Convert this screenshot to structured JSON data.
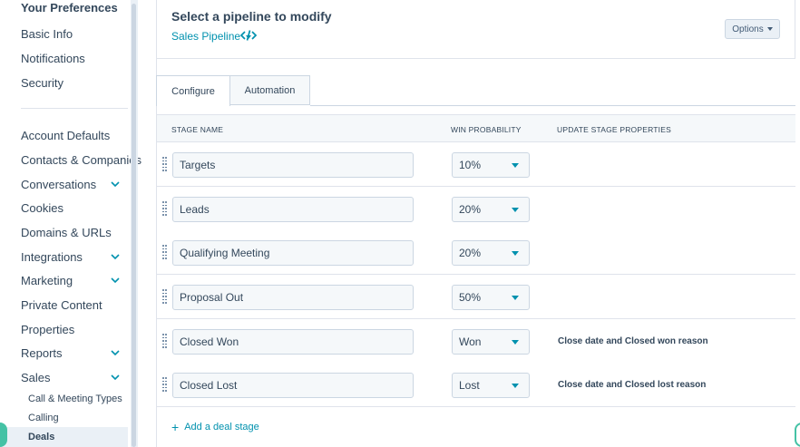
{
  "sidebar": {
    "header": "Your Preferences",
    "pref_items": [
      {
        "label": "Basic Info"
      },
      {
        "label": "Notifications"
      },
      {
        "label": "Security"
      }
    ],
    "items": [
      {
        "label": "Account Defaults",
        "expandable": false
      },
      {
        "label": "Contacts & Companies",
        "expandable": false
      },
      {
        "label": "Conversations",
        "expandable": true
      },
      {
        "label": "Cookies",
        "expandable": false
      },
      {
        "label": "Domains & URLs",
        "expandable": false
      },
      {
        "label": "Integrations",
        "expandable": true
      },
      {
        "label": "Marketing",
        "expandable": true
      },
      {
        "label": "Private Content",
        "expandable": false
      },
      {
        "label": "Properties",
        "expandable": false
      },
      {
        "label": "Reports",
        "expandable": true
      },
      {
        "label": "Sales",
        "expandable": true
      }
    ],
    "sub_items": [
      {
        "label": "Call & Meeting Types"
      },
      {
        "label": "Calling"
      },
      {
        "label": "Deals",
        "active": true
      }
    ]
  },
  "header": {
    "title": "Select a pipeline to modify",
    "pipeline": "Sales Pipeline",
    "options_label": "Options",
    "code_icon": "code-icon"
  },
  "tabs": [
    {
      "label": "Configure",
      "active": true
    },
    {
      "label": "Automation",
      "active": false
    }
  ],
  "table": {
    "columns": [
      "STAGE NAME",
      "WIN PROBABILITY",
      "UPDATE STAGE PROPERTIES"
    ],
    "rows": [
      {
        "stage": "Targets",
        "probability": "10%",
        "properties": ""
      },
      {
        "stage": "Leads",
        "probability": "20%",
        "properties": ""
      },
      {
        "stage": "Qualifying Meeting",
        "probability": "20%",
        "properties": ""
      },
      {
        "stage": "Proposal Out",
        "probability": "50%",
        "properties": ""
      },
      {
        "stage": "Closed Won",
        "probability": "Won",
        "properties": "Close date and Closed won reason"
      },
      {
        "stage": "Closed Lost",
        "probability": "Lost",
        "properties": "Close date and Closed lost reason"
      }
    ]
  },
  "add_stage_label": "Add a deal stage",
  "colors": {
    "accent": "#0091ae",
    "text": "#33475b",
    "border": "#cbd6e2",
    "bg_light": "#f5f8fa"
  }
}
